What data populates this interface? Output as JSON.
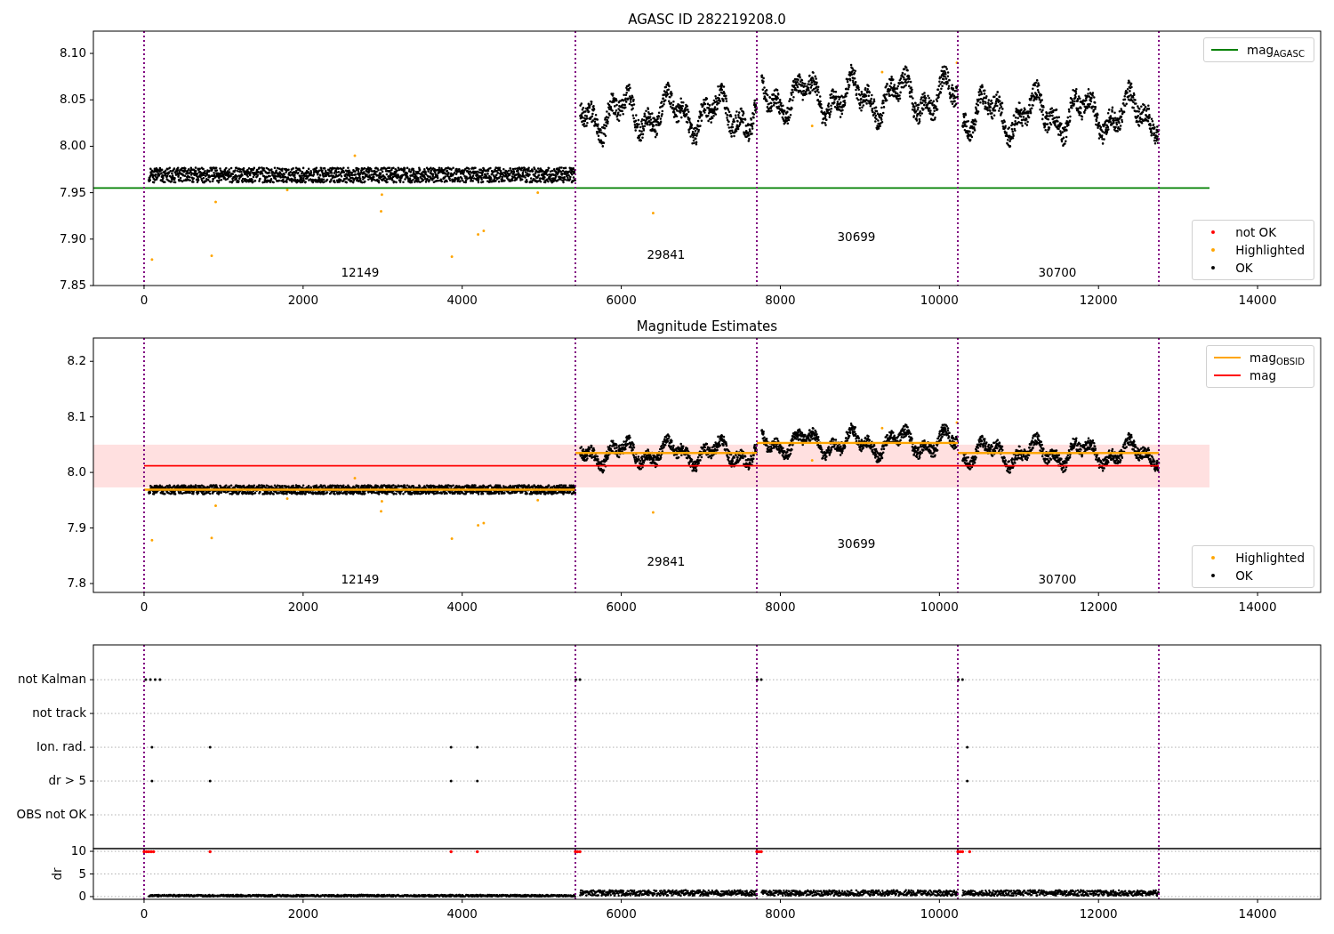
{
  "figure": {
    "panels": [
      {
        "legends": [
          {
            "entries": [
              {
                "label": "mag$_{AGASC}$",
                "kind": "line",
                "color": "#008000"
              }
            ]
          },
          {
            "entries": [
              {
                "label": "not OK",
                "kind": "marker",
                "color": "#ff0000"
              },
              {
                "label": "Highlighted",
                "kind": "marker",
                "color": "#ffa500"
              },
              {
                "label": "OK",
                "kind": "marker",
                "color": "#000000"
              }
            ]
          }
        ],
        "chart_data": {
          "type": "line",
          "title": "AGASC ID 282219208.0",
          "xlim": [
            -637,
            14793
          ],
          "ylim": [
            7.85,
            8.124
          ],
          "xticks": [
            0,
            2000,
            4000,
            6000,
            8000,
            10000,
            12000,
            14000
          ],
          "yticks": [
            {
              "value": 7.85,
              "label": "7.85"
            },
            {
              "value": 7.9,
              "label": "7.90"
            },
            {
              "value": 7.95,
              "label": "7.95"
            },
            {
              "value": 8.0,
              "label": "8.00"
            },
            {
              "value": 8.05,
              "label": "8.05"
            },
            {
              "value": 8.1,
              "label": "8.10"
            }
          ],
          "x": [
            -637,
            13395
          ],
          "series": [
            {
              "color": "#008000",
              "values": [
                7.955,
                7.955
              ]
            }
          ],
          "ref_lines": [
            {
              "axis": "x",
              "value": 0,
              "color": "#800080"
            },
            {
              "axis": "x",
              "value": 5423,
              "color": "#800080"
            },
            {
              "axis": "x",
              "value": 7704,
              "color": "#800080"
            },
            {
              "axis": "x",
              "value": 10231,
              "color": "#800080"
            },
            {
              "axis": "x",
              "value": 12759,
              "color": "#800080"
            }
          ],
          "annotations": [
            "12149",
            "29841",
            "30699",
            "30700"
          ]
        }
      },
      {
        "legends": [
          {
            "entries": [
              {
                "label": "mag$_{OBSID}$",
                "kind": "line",
                "color": "#ffa500"
              },
              {
                "label": "mag",
                "kind": "line",
                "color": "#ff0000"
              }
            ]
          },
          {
            "entries": [
              {
                "label": "Highlighted",
                "kind": "marker",
                "color": "#ffa500"
              },
              {
                "label": "OK",
                "kind": "marker",
                "color": "#000000"
              }
            ]
          }
        ],
        "chart_data": {
          "type": "line",
          "title": "Magnitude Estimates",
          "xlim": [
            -637,
            14793
          ],
          "ylim": [
            7.784,
            8.242
          ],
          "xticks": [
            0,
            2000,
            4000,
            6000,
            8000,
            10000,
            12000,
            14000
          ],
          "yticks": [
            {
              "value": 7.8,
              "label": "7.8"
            },
            {
              "value": 7.9,
              "label": "7.9"
            },
            {
              "value": 8.0,
              "label": "8.0"
            },
            {
              "value": 8.1,
              "label": "8.1"
            },
            {
              "value": 8.2,
              "label": "8.2"
            }
          ],
          "x": [
            0,
            5423,
            5423,
            5423,
            7704,
            7704,
            7704,
            10231,
            10231,
            10231,
            12759
          ],
          "series": [
            {
              "color": "#ffa500",
              "values": [
                7.969,
                7.969,
                null,
                8.035,
                8.035,
                null,
                8.053,
                8.053,
                null,
                8.035,
                8.035
              ]
            },
            {
              "color": "#ff0000",
              "values": [
                8.012,
                8.012,
                8.012,
                8.012,
                8.012,
                8.012,
                8.012,
                8.012,
                8.012,
                8.012,
                8.012
              ]
            }
          ],
          "bands": [
            {
              "axis": "y",
              "from": 7.973,
              "to": 8.05,
              "color": "#ff0000"
            }
          ],
          "ref_lines": [
            {
              "axis": "x",
              "value": 0,
              "color": "#800080"
            },
            {
              "axis": "x",
              "value": 5423,
              "color": "#800080"
            },
            {
              "axis": "x",
              "value": 7704,
              "color": "#800080"
            },
            {
              "axis": "x",
              "value": 10231,
              "color": "#800080"
            },
            {
              "axis": "x",
              "value": 12759,
              "color": "#800080"
            }
          ],
          "annotations": [
            "12149",
            "29841",
            "30699",
            "30700"
          ]
        }
      },
      {
        "chart_data": {
          "type": "scatter",
          "orientation": "horizontal",
          "xlim": [
            -637,
            14793
          ],
          "grid": true,
          "categories": [
            "not Kalman",
            "not track",
            "Ion. rad.",
            "dr > 5",
            "OBS not OK"
          ],
          "ref_lines": [
            {
              "axis": "x",
              "value": 0,
              "color": "#800080"
            },
            {
              "axis": "x",
              "value": 5423,
              "color": "#800080"
            },
            {
              "axis": "x",
              "value": 7704,
              "color": "#800080"
            },
            {
              "axis": "x",
              "value": 10231,
              "color": "#800080"
            },
            {
              "axis": "x",
              "value": 12759,
              "color": "#800080"
            }
          ]
        }
      },
      {
        "chart_data": {
          "type": "scatter",
          "ylabel": "dr",
          "xlim": [
            -637,
            14793
          ],
          "ylim": [
            -0.6,
            10.6
          ],
          "grid": true,
          "xticks": [
            0,
            2000,
            4000,
            6000,
            8000,
            10000,
            12000,
            14000
          ],
          "yticks": [
            0,
            5,
            10
          ],
          "ref_lines": [
            {
              "axis": "x",
              "value": 0,
              "color": "#800080"
            },
            {
              "axis": "x",
              "value": 5423,
              "color": "#800080"
            },
            {
              "axis": "x",
              "value": 7704,
              "color": "#800080"
            },
            {
              "axis": "x",
              "value": 10231,
              "color": "#800080"
            },
            {
              "axis": "x",
              "value": 12759,
              "color": "#800080"
            }
          ]
        }
      }
    ]
  }
}
